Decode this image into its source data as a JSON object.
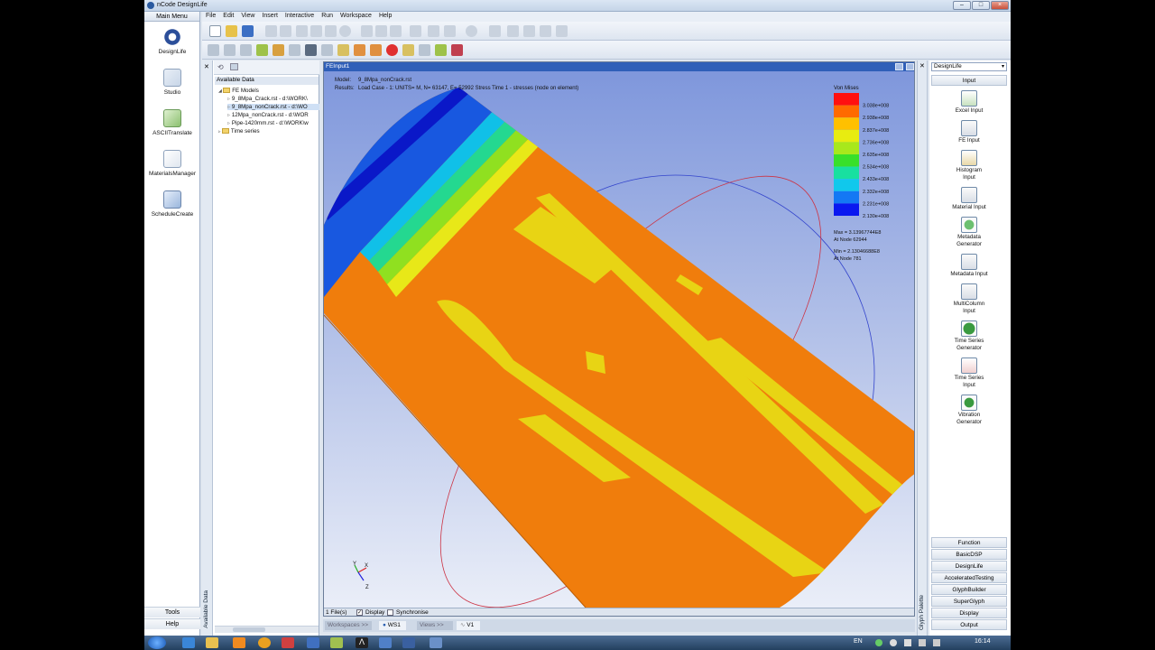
{
  "app": {
    "title": "nCode DesignLife"
  },
  "menu": [
    "File",
    "Edit",
    "View",
    "Insert",
    "Interactive",
    "Run",
    "Workspace",
    "Help"
  ],
  "left_nav": {
    "header": "Main Menu",
    "items": [
      {
        "label": "DesignLife",
        "icon": "designlife-icon"
      },
      {
        "label": "Studio",
        "icon": "studio-icon"
      },
      {
        "label": "ASCIITranslate",
        "icon": "ascii-translate-icon"
      },
      {
        "label": "MaterialsManager",
        "icon": "materials-manager-icon"
      },
      {
        "label": "ScheduleCreate",
        "icon": "schedule-create-icon"
      }
    ],
    "tools": "Tools",
    "help": "Help"
  },
  "available_data": {
    "title": "Available Data",
    "strip_label": "Available Data",
    "fe_models": "FE Models",
    "files": [
      "9_8Mpa_Crack.rst - d:\\WORK\\",
      "9_8Mpa_nonCrack.rst - d:\\WO",
      "12Mpa_nonCrack.rst - d:\\WOR",
      "Pipe-1420mm.rst - d:\\WORK\\w"
    ],
    "time_series": "Time series"
  },
  "viewer": {
    "tab": "FEInput1",
    "model_label": "Model:",
    "model": "9_8Mpa_nonCrack.rst",
    "results_label": "Results:",
    "results": "Load Case - 1: UNITS= M, N= 63147, E= 52992 Stress Time 1 - stresses (node on element)",
    "legend_title": "Von Mises",
    "legend_values": [
      "3.038e+008",
      "2.938e+008",
      "2.837e+008",
      "2.736e+008",
      "2.635e+008",
      "2.534e+008",
      "2.433e+008",
      "2.332e+008",
      "2.231e+008",
      "2.130e+008"
    ],
    "legend_colors": [
      "#ff1010",
      "#ff6a00",
      "#ffc000",
      "#e8ec10",
      "#a8e81c",
      "#38e02a",
      "#18e0a0",
      "#10c8ec",
      "#1478f4",
      "#0a18f0"
    ],
    "max_line": "Max = 3.13967744E8",
    "max_node": "At Node 62944",
    "min_line": "Min = 2.13046688E8",
    "min_node": "At Node 781",
    "axes": {
      "x": "X",
      "y": "Y",
      "z": "Z"
    },
    "status": {
      "files": "1 File(s)",
      "display": "Display",
      "synchronise": "Synchronise"
    }
  },
  "workspace_bar": {
    "workspaces": "Workspaces >>",
    "ws": "WS1",
    "views": "Views >>",
    "view": "V1"
  },
  "palette": {
    "selector": "DesignLife",
    "strip_label": "Glyph Palette",
    "input_header": "Input",
    "glyphs": [
      "Excel Input",
      "FE Input",
      "Histogram Input",
      "Material Input",
      "Metadata Generator",
      "Metadata Input",
      "MultiColumn Input",
      "Time Series Generator",
      "Time Series Input",
      "Vibration Generator"
    ],
    "categories": [
      "Function",
      "BasicDSP",
      "DesignLife",
      "AcceleratedTesting",
      "GlyphBuilder",
      "SuperGlyph",
      "Display",
      "Output"
    ]
  },
  "taskbar": {
    "lang": "EN",
    "time": "16:14"
  }
}
